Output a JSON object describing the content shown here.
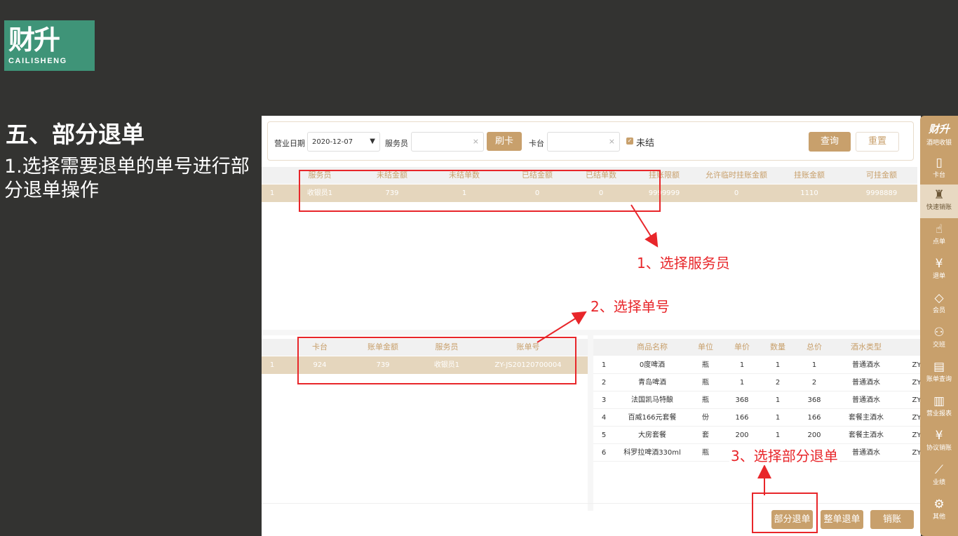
{
  "logo": {
    "main": "财升",
    "sub": "CAILISHENG"
  },
  "slide": {
    "title": "五、部分退单",
    "description": "1.选择需要退单的单号进行部分退单操作"
  },
  "filter": {
    "date_label": "营业日期",
    "date_value": "2020-12-07",
    "waiter_label": "服务员",
    "swipe_card": "刷卡",
    "table_label": "卡台",
    "unsettled_label": "未结",
    "query": "查询",
    "reset": "重置"
  },
  "waiter_table": {
    "headers": [
      "服务员",
      "未结金额",
      "未结单数",
      "已结金额",
      "已结单数",
      "挂账限额",
      "允许临时挂账金额",
      "挂账金额",
      "可挂金额"
    ],
    "rows": [
      [
        "1",
        "收银员1",
        "739",
        "1",
        "0",
        "0",
        "9999999",
        "0",
        "1110",
        "9998889"
      ]
    ]
  },
  "bill_table": {
    "headers": [
      "卡台",
      "账单金额",
      "服务员",
      "账单号"
    ],
    "rows": [
      [
        "1",
        "924",
        "739",
        "收银员1",
        "ZY-JS20120700004"
      ]
    ]
  },
  "item_table": {
    "headers": [
      "商品名称",
      "单位",
      "单价",
      "数量",
      "总价",
      "酒水类型"
    ],
    "rows": [
      [
        "1",
        "0度啤酒",
        "瓶",
        "1",
        "1",
        "1",
        "普通酒水",
        "ZY"
      ],
      [
        "2",
        "青岛啤酒",
        "瓶",
        "1",
        "2",
        "2",
        "普通酒水",
        "ZY"
      ],
      [
        "3",
        "法国凯马特酿",
        "瓶",
        "368",
        "1",
        "368",
        "普通酒水",
        "ZY"
      ],
      [
        "4",
        "百威166元套餐",
        "份",
        "166",
        "1",
        "166",
        "套餐主酒水",
        "ZY"
      ],
      [
        "5",
        "大房套餐",
        "套",
        "200",
        "1",
        "200",
        "套餐主酒水",
        "ZY"
      ],
      [
        "6",
        "科罗拉啤酒330ml",
        "瓶",
        "",
        "",
        "",
        "普通酒水",
        "ZY"
      ]
    ]
  },
  "buttons": {
    "partial_refund": "部分退单",
    "full_refund": "整单退单",
    "write_off": "销账"
  },
  "annotations": {
    "step1": "1、选择服务员",
    "step2": "2、选择单号",
    "step3": "3、选择部分退单"
  },
  "sidebar": {
    "brand": "财升",
    "brand_sub": "酒吧收银",
    "items": [
      {
        "icon": "card-icon",
        "glyph": "▯",
        "label": "卡台"
      },
      {
        "icon": "bottle-icon",
        "glyph": "♜",
        "label": "快速销账",
        "active": true
      },
      {
        "icon": "hand-pointer-icon",
        "glyph": "☝",
        "label": "点单"
      },
      {
        "icon": "yuan-circle-icon",
        "glyph": "¥",
        "label": "退单"
      },
      {
        "icon": "diamond-icon",
        "glyph": "◇",
        "label": "会员"
      },
      {
        "icon": "users-icon",
        "glyph": "⚇",
        "label": "交班"
      },
      {
        "icon": "document-icon",
        "glyph": "▤",
        "label": "账单查询"
      },
      {
        "icon": "report-icon",
        "glyph": "▥",
        "label": "营业报表"
      },
      {
        "icon": "agreement-icon",
        "glyph": "¥",
        "label": "协议销账"
      },
      {
        "icon": "chart-icon",
        "glyph": "⟋",
        "label": "业绩"
      },
      {
        "icon": "gear-icon",
        "glyph": "⚙",
        "label": "其他"
      }
    ]
  },
  "colors": {
    "accent": "#c8a06c",
    "annotation": "#e8262a",
    "logo_bg": "#3f9478",
    "page_bg": "#333331"
  }
}
